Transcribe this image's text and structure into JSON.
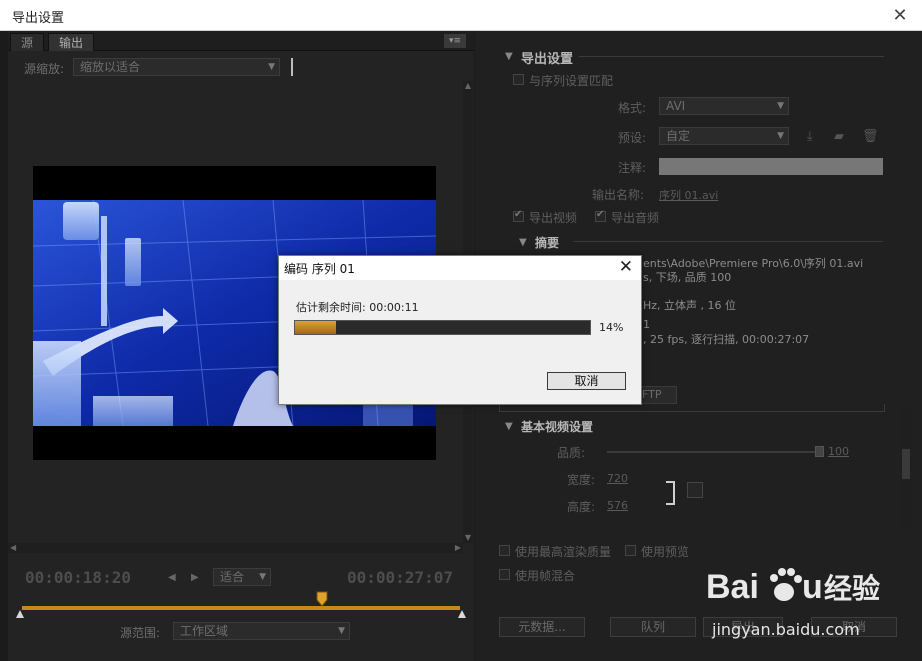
{
  "window": {
    "title": "导出设置",
    "close_glyph": "✕"
  },
  "left_panel": {
    "tabs": [
      "源",
      "输出"
    ],
    "panel_menu_glyph": "▾≡",
    "source_scale_label": "源缩放:",
    "source_scale_value": "缩放以适合",
    "current_time": "00:00:18:20",
    "fit_value": "适合",
    "end_time": "00:00:27:07",
    "source_range_label": "源范围:",
    "source_range_value": "工作区域"
  },
  "right_panel": {
    "export_settings_title": "导出设置",
    "match_sequence_label": "与序列设置匹配",
    "format_label": "格式:",
    "format_value": "AVI",
    "preset_label": "预设:",
    "preset_value": "自定",
    "comment_label": "注释:",
    "output_name_label": "输出名称:",
    "output_name_value": "序列 01.avi",
    "export_video_label": "导出视频",
    "export_audio_label": "导出音频",
    "summary_title": "摘要",
    "summary_lines": [
      "ents\\Adobe\\Premiere Pro\\6.0\\序列  01.avi",
      "s, 下场, 品质  100",
      "Hz, 立体声 , 16 位",
      "1",
      ", 25 fps, 逐行扫描, 00:00:27:07"
    ],
    "ftp_tab_label": "FTP",
    "basic_video_title": "基本视频设置",
    "quality_label": "品质:",
    "quality_value": "100",
    "width_label": "宽度:",
    "width_value": "720",
    "height_label": "高度:",
    "height_value": "576",
    "max_render_label": "使用最高渲染质量",
    "use_preview_label": "使用预览",
    "frame_blend_label": "使用帧混合",
    "metadata_button": "元数据...",
    "queue_button": "队列",
    "export_button": "导出",
    "cancel_button": "取消"
  },
  "dialog": {
    "title": "编码 序列 01",
    "estimate_label": "估计剩余时间:",
    "estimate_value": "00:00:11",
    "progress_percent": 14,
    "progress_text": "14%",
    "cancel_label": "取消"
  },
  "watermark": {
    "brand": "Bai du 经验",
    "url": "jingyan.baidu.com"
  },
  "colors": {
    "accent": "#c7891b",
    "progress": "#d9a23a"
  }
}
